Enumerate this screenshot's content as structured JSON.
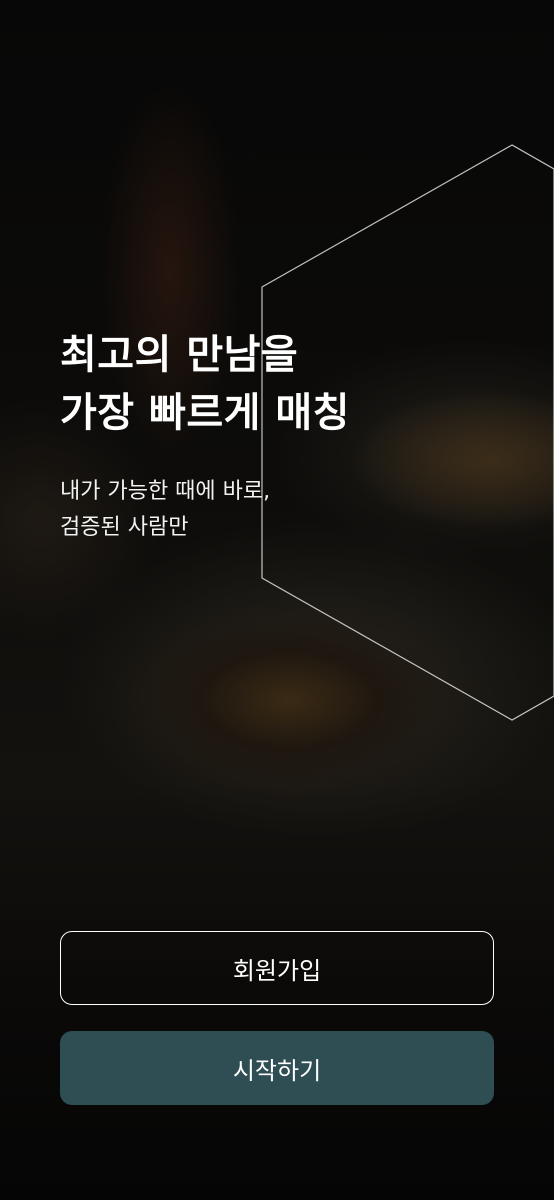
{
  "hero": {
    "headline_line1": "최고의 만남을",
    "headline_line2": "가장 빠르게 매칭",
    "subtitle_line1": "내가 가능한 때에 바로,",
    "subtitle_line2": "검증된 사람만"
  },
  "actions": {
    "signup_label": "회원가입",
    "start_label": "시작하기"
  },
  "colors": {
    "primary_button": "#2e4e53",
    "text": "#ffffff"
  }
}
